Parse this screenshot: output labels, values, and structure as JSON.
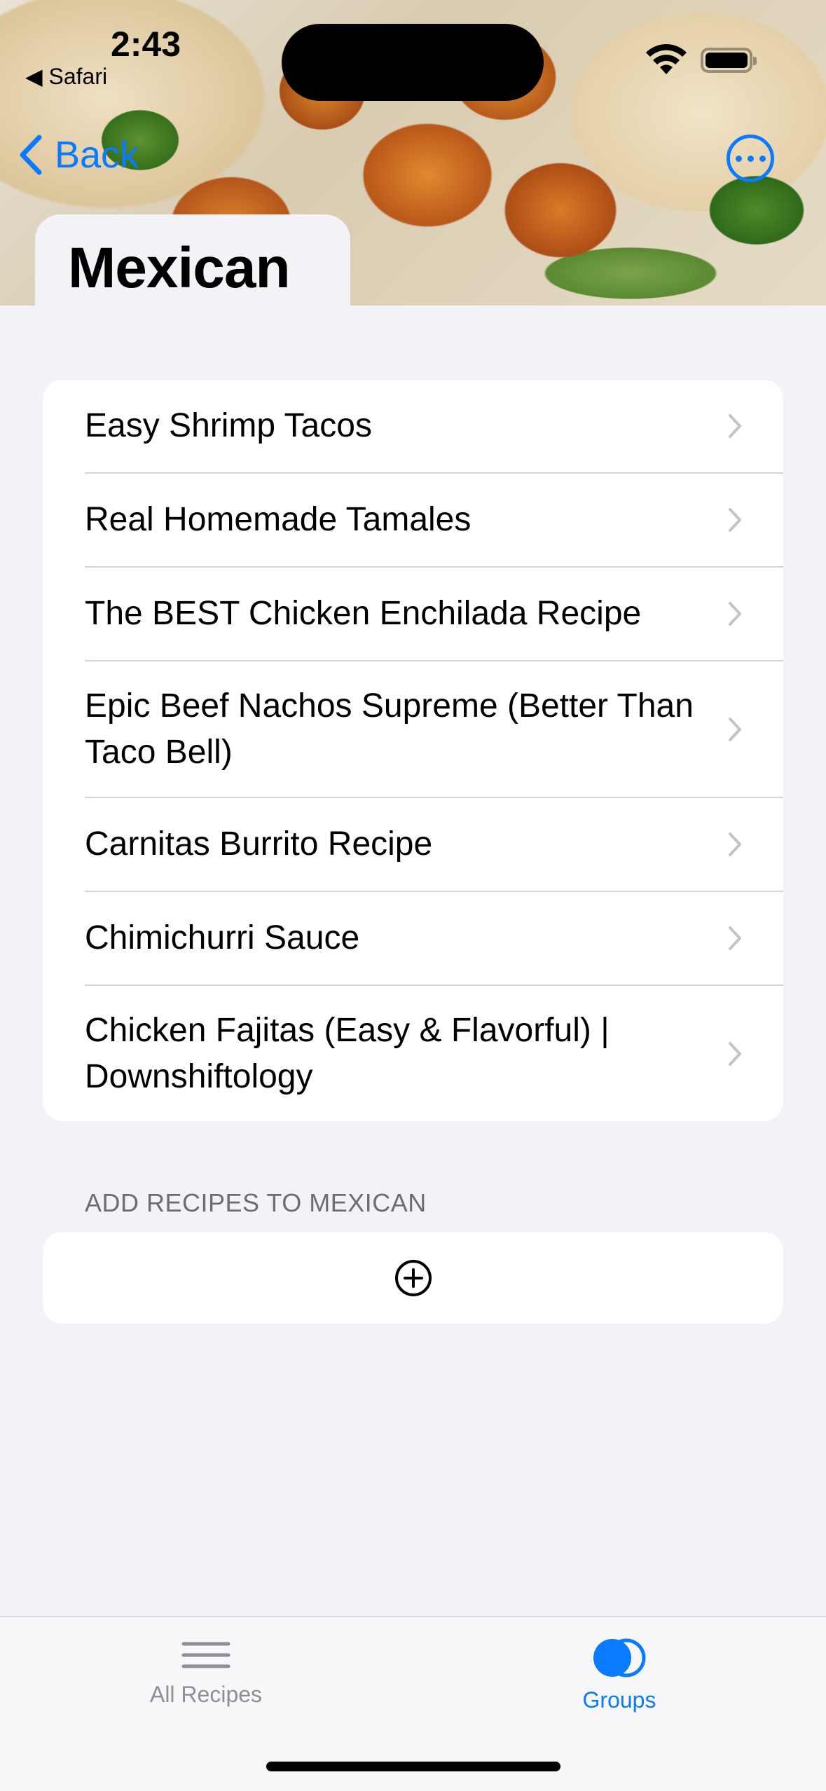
{
  "status_bar": {
    "time": "2:43",
    "back_app": "◀ Safari"
  },
  "nav": {
    "back_label": "Back",
    "title": "Mexican",
    "accent_color": "#0a7aff"
  },
  "recipes": [
    "Easy Shrimp Tacos",
    "Real Homemade Tamales",
    "The BEST Chicken Enchilada Recipe",
    "Epic Beef Nachos Supreme (Better Than Taco Bell)",
    "Carnitas Burrito Recipe",
    "Chimichurri Sauce",
    "Chicken Fajitas (Easy & Flavorful) | Downshiftology"
  ],
  "add_section": {
    "header": "ADD RECIPES TO MEXICAN",
    "icon": "plus-circle-icon"
  },
  "tabbar": {
    "recipes_label": "All Recipes",
    "groups_label": "Groups",
    "selected": "Groups"
  }
}
